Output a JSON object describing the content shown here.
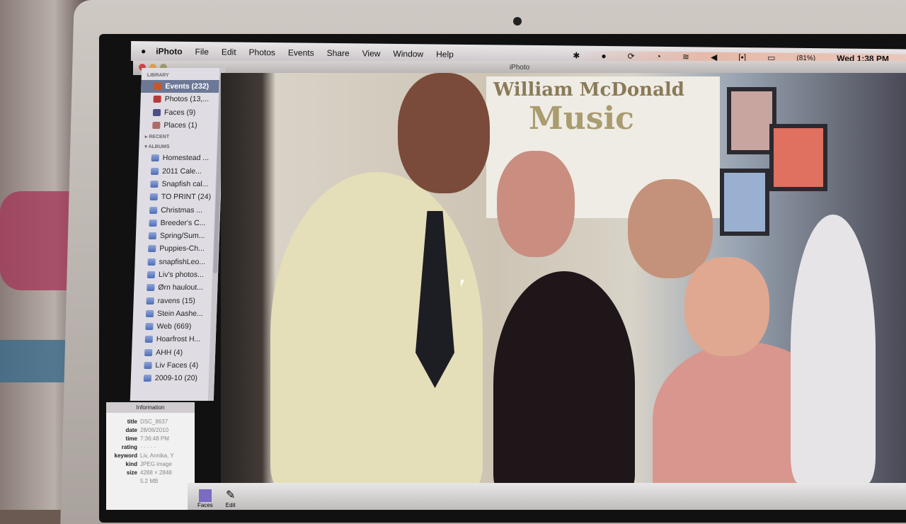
{
  "menubar": {
    "app": "iPhoto",
    "items": [
      "File",
      "Edit",
      "Photos",
      "Events",
      "Share",
      "View",
      "Window",
      "Help"
    ],
    "battery": "(81%)",
    "clock": "Wed 1:38 PM"
  },
  "window_title": "iPhoto",
  "sidebar": {
    "library_header": "LIBRARY",
    "library": [
      {
        "label": "Events (232)",
        "selected": true,
        "color": "#c8552b"
      },
      {
        "label": "Photos (13,...",
        "color": "#b53a3a"
      },
      {
        "label": "Faces (9)",
        "color": "#4a4f8a"
      },
      {
        "label": "Places (1)",
        "color": "#b06a6a"
      }
    ],
    "recent_header": "RECENT",
    "albums_header": "ALBUMS",
    "albums": [
      "Homestead ...",
      "2011 Cale...",
      "Snapfish cal...",
      "TO PRINT (24)",
      "Christmas ...",
      "Breeder's C...",
      "Spring/Sum...",
      "Puppies-Ch...",
      "snapfishLeo...",
      "Liv's photos...",
      "Ørn haulout...",
      "ravens (15)",
      "Stein Aashe...",
      "Web (669)",
      "Hoarfrost H...",
      "AHH (4)",
      "Liv Faces (4)",
      "2009-10 (20)"
    ]
  },
  "info": {
    "header": "Information",
    "rows": [
      {
        "k": "title",
        "v": "DSC_8637"
      },
      {
        "k": "date",
        "v": "28/06/2010"
      },
      {
        "k": "time",
        "v": "7:36:48 PM"
      },
      {
        "k": "rating",
        "v": "· · · · ·"
      },
      {
        "k": "keyword",
        "v": "Liv, Annika, Y"
      },
      {
        "k": "kind",
        "v": "JPEG image"
      },
      {
        "k": "size",
        "v": "4288 × 2848"
      },
      {
        "k": "",
        "v": "5.2 MB"
      }
    ]
  },
  "photo": {
    "poster_line1": "William McDonald",
    "poster_line2": "Music"
  },
  "toolbar": {
    "faces": "Faces",
    "edit": "Edit"
  }
}
